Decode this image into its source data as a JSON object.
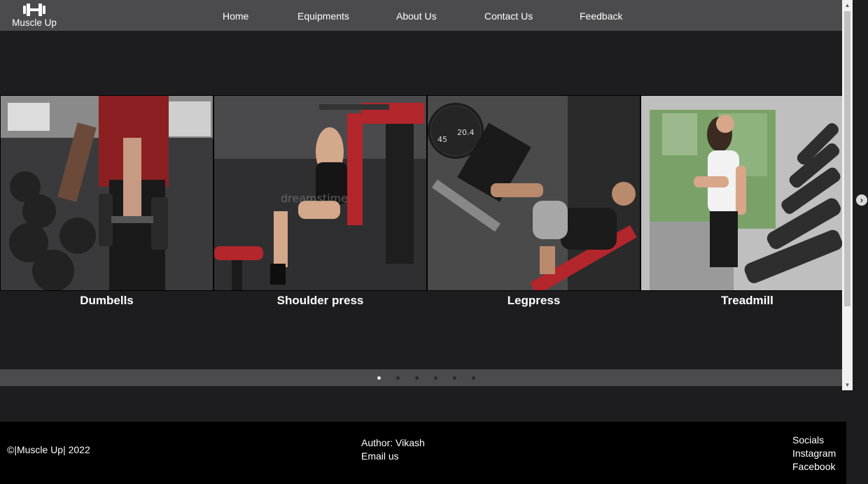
{
  "header": {
    "logo_text": "Muscle Up",
    "nav": [
      "Home",
      "Equipments",
      "About Us",
      "Contact Us",
      "Feedback"
    ]
  },
  "slider": {
    "slides": [
      {
        "caption": "Dumbells",
        "image": "person holding dumbbells at rack"
      },
      {
        "caption": "Shoulder press",
        "image": "woman on shoulder press machine",
        "watermark": "dreamstime"
      },
      {
        "caption": "Legpress",
        "image": "man on leg press machine",
        "plate_labels": [
          "45",
          "20.4"
        ]
      },
      {
        "caption": "Treadmill",
        "image": "woman running on treadmill"
      }
    ],
    "dot_count": 6,
    "active_dot": 0
  },
  "footer": {
    "copyright": "©|Muscle Up| 2022",
    "author": "Author: Vikash",
    "email": "Email us",
    "socials_title": "Socials",
    "socials": [
      "Instagram",
      "Facebook"
    ]
  },
  "icons": {
    "logo": "dumbbell-icon",
    "next": "chevron-right-icon",
    "scroll_up": "scroll-up-arrow-icon",
    "scroll_down": "scroll-down-arrow-icon"
  },
  "colors": {
    "page_bg": "#1d1d1f",
    "navbar_bg": "#4b4b4d",
    "footer_bg": "#000000",
    "accent_red": "#c8202a"
  }
}
